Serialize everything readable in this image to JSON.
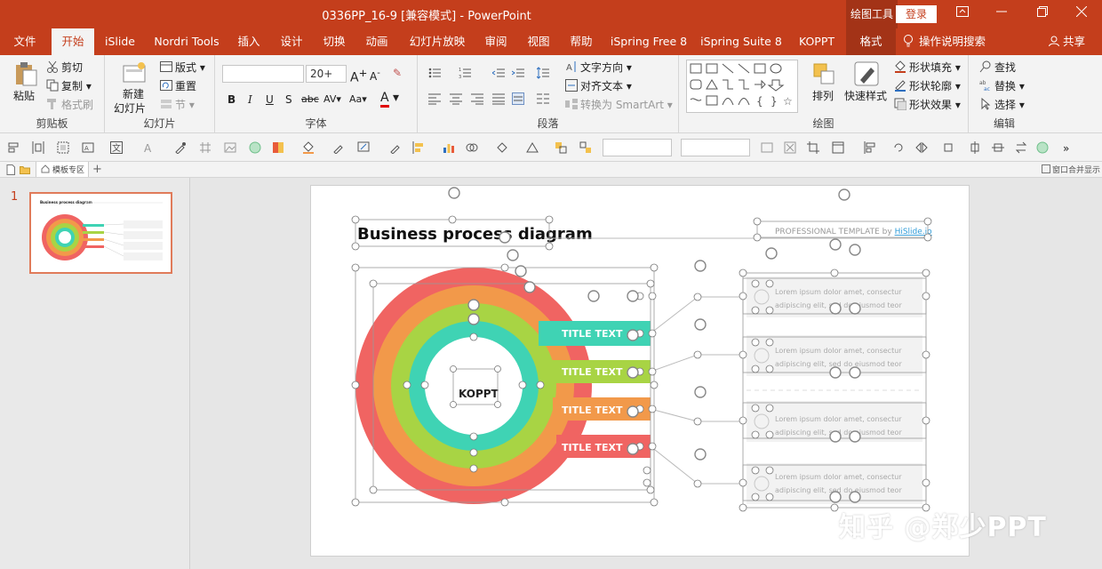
{
  "titlebar": {
    "title": "0336PP_16-9 [兼容模式]  -  PowerPoint",
    "context_tool": "绘图工具",
    "login": "登录"
  },
  "tabs": [
    "文件",
    "开始",
    "iSlide",
    "Nordri Tools",
    "插入",
    "设计",
    "切换",
    "动画",
    "幻灯片放映",
    "审阅",
    "视图",
    "帮助",
    "iSpring Free 8",
    "iSpring Suite 8",
    "KOPPT",
    "格式"
  ],
  "active_tab": "开始",
  "tell_me": "操作说明搜索",
  "share": "共享",
  "ribbon": {
    "clipboard": {
      "label": "剪贴板",
      "paste": "粘贴",
      "cut": "剪切",
      "copy": "复制",
      "format_painter": "格式刷"
    },
    "slides": {
      "label": "幻灯片",
      "new_slide_1": "新建",
      "new_slide_2": "幻灯片",
      "layout": "版式",
      "reset": "重置",
      "section": "节"
    },
    "font": {
      "label": "字体",
      "font_name": "",
      "font_size": "20+"
    },
    "paragraph": {
      "label": "段落",
      "text_direction": "文字方向",
      "align_text": "对齐文本",
      "smartart": "转换为 SmartArt"
    },
    "drawing": {
      "label": "绘图",
      "arrange": "排列",
      "quick_styles": "快速样式",
      "shape_fill": "形状填充",
      "shape_outline": "形状轮廓",
      "shape_effects": "形状效果"
    },
    "editing": {
      "label": "编辑",
      "find": "查找",
      "replace": "替换",
      "select": "选择"
    }
  },
  "tabstrip": {
    "tab_label": "模板专区",
    "right_label": "窗口合并显示"
  },
  "slide_panel": {
    "slide_number": "1"
  },
  "slide": {
    "title": "Business process diagram",
    "subtitle_prefix": "PROFESSIONAL TEMPLATE by ",
    "subtitle_link": "HiSlide.io",
    "center_label": "KOPPT",
    "items": [
      {
        "title": "TITLE TEXT",
        "color": "#3fd3b4",
        "line1": "Lorem ipsum dolor amet, consectur",
        "line2": "adipiscing elit, sed do eiusmod teor"
      },
      {
        "title": "TITLE TEXT",
        "color": "#a8d444",
        "line1": "Lorem ipsum dolor amet, consectur",
        "line2": "adipiscing elit, sed do eiusmod teor"
      },
      {
        "title": "TITLE TEXT",
        "color": "#f2994a",
        "line1": "Lorem ipsum dolor amet, consectur",
        "line2": "adipiscing elit, sed do eiusmod teor"
      },
      {
        "title": "TITLE TEXT",
        "color": "#f06462",
        "line1": "Lorem ipsum dolor amet, consectur",
        "line2": "adipiscing elit, sed do eiusmod teor"
      }
    ]
  },
  "watermark": "知乎 @郑少PPT",
  "colors": {
    "accent": "#c43e1c",
    "ring_red": "#f06462",
    "ring_orange": "#f2994a",
    "ring_green": "#a8d444",
    "ring_teal": "#3fd3b4"
  }
}
